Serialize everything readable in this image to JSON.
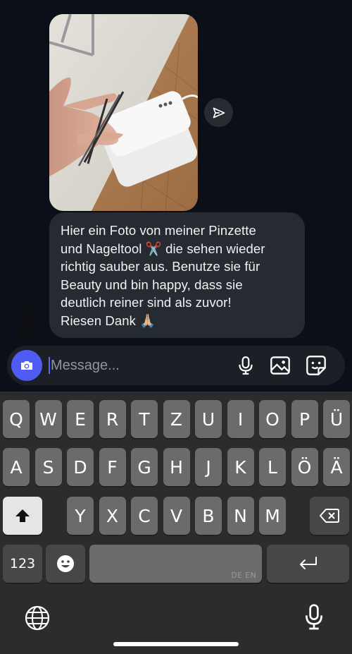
{
  "message": {
    "text": "Hier ein Foto von meiner Pinzette\nund Nageltool ✂️ die sehen wieder\nrichtig sauber aus. Benutze sie für\nBeauty und bin happy, dass sie\ndeutlich reiner sind als zuvor!\nRiesen Dank 🙏🏼"
  },
  "composer": {
    "placeholder": "Message..."
  },
  "keyboard": {
    "row1": [
      "Q",
      "W",
      "E",
      "R",
      "T",
      "Z",
      "U",
      "I",
      "O",
      "P",
      "Ü"
    ],
    "row2": [
      "A",
      "S",
      "D",
      "F",
      "G",
      "H",
      "J",
      "K",
      "L",
      "Ö",
      "Ä"
    ],
    "row3": [
      "Y",
      "X",
      "C",
      "V",
      "B",
      "N",
      "M"
    ],
    "numbers_label": "123",
    "space_lang": "DE EN"
  },
  "icons": {
    "share": "send-icon",
    "camera": "camera-icon",
    "mic": "microphone-icon",
    "gallery": "gallery-icon",
    "sticker": "sticker-icon",
    "shift": "shift-arrow-icon",
    "backspace": "backspace-icon",
    "emoji": "emoji-icon",
    "return": "return-icon",
    "globe": "globe-icon",
    "dictation": "dictation-mic-icon"
  },
  "colors": {
    "background": "#0b0f17",
    "bubble": "#262a31",
    "accent": "#4f5bf2",
    "keyboard": "#2c2c2e"
  }
}
